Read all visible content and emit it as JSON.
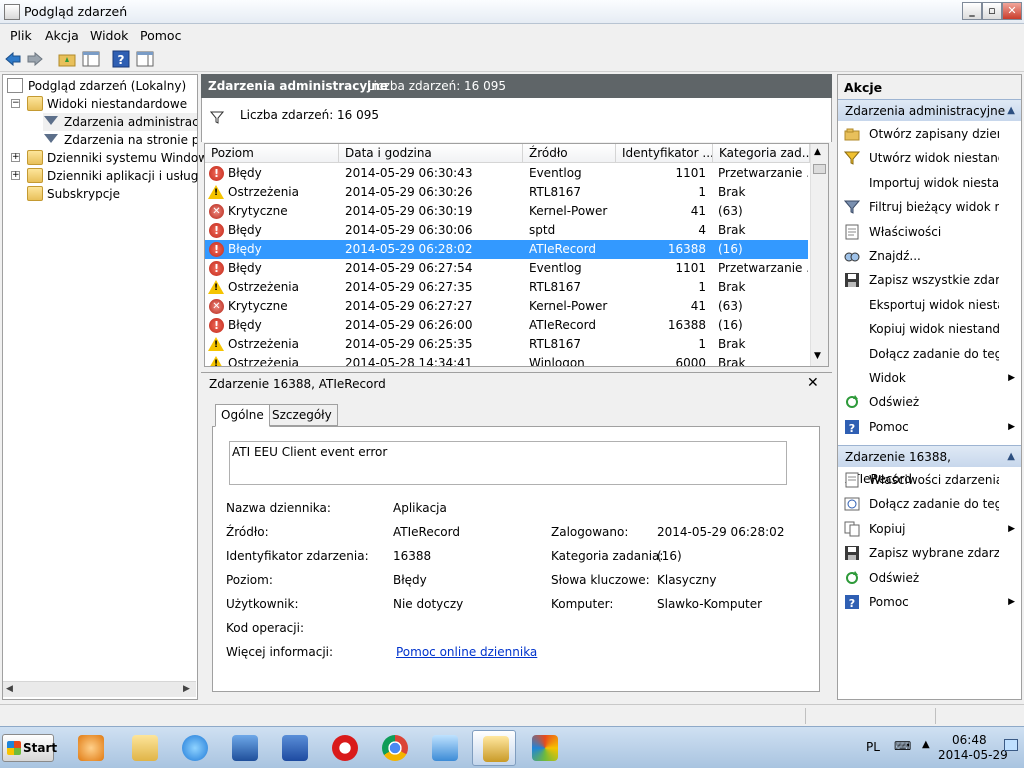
{
  "window": {
    "title": "Podgląd zdarzeń"
  },
  "menu": [
    "Plik",
    "Akcja",
    "Widok",
    "Pomoc"
  ],
  "tree": {
    "root": "Podgląd zdarzeń (Lokalny)",
    "custom_views": "Widoki niestandardowe",
    "admin_events": "Zdarzenia administracyjne",
    "page_events": "Zdarzenia na stronie pod",
    "windows_logs": "Dzienniki systemu Windows",
    "app_logs": "Dzienniki aplikacji i usług",
    "subscriptions": "Subskrypcje"
  },
  "center": {
    "title": "Zdarzenia administracyjne",
    "count_header": "Liczba zdarzeń: 16 095",
    "filter_text": "Liczba zdarzeń: 16 095"
  },
  "table": {
    "columns": [
      "Poziom",
      "Data i godzina",
      "Źródło",
      "Identyfikator ...",
      "Kategoria zad..."
    ],
    "rows": [
      {
        "level": "Błędy",
        "type": "error",
        "date": "2014-05-29 06:30:43",
        "source": "Eventlog",
        "id": "1101",
        "category": "Przetwarzanie ..."
      },
      {
        "level": "Ostrzeżenia",
        "type": "warning",
        "date": "2014-05-29 06:30:26",
        "source": "RTL8167",
        "id": "1",
        "category": "Brak"
      },
      {
        "level": "Krytyczne",
        "type": "critical",
        "date": "2014-05-29 06:30:19",
        "source": "Kernel-Power",
        "id": "41",
        "category": "(63)"
      },
      {
        "level": "Błędy",
        "type": "error",
        "date": "2014-05-29 06:30:06",
        "source": "sptd",
        "id": "4",
        "category": "Brak"
      },
      {
        "level": "Błędy",
        "type": "error",
        "date": "2014-05-29 06:28:02",
        "source": "ATIeRecord",
        "id": "16388",
        "category": "(16)",
        "selected": true
      },
      {
        "level": "Błędy",
        "type": "error",
        "date": "2014-05-29 06:27:54",
        "source": "Eventlog",
        "id": "1101",
        "category": "Przetwarzanie ..."
      },
      {
        "level": "Ostrzeżenia",
        "type": "warning",
        "date": "2014-05-29 06:27:35",
        "source": "RTL8167",
        "id": "1",
        "category": "Brak"
      },
      {
        "level": "Krytyczne",
        "type": "critical",
        "date": "2014-05-29 06:27:27",
        "source": "Kernel-Power",
        "id": "41",
        "category": "(63)"
      },
      {
        "level": "Błędy",
        "type": "error",
        "date": "2014-05-29 06:26:00",
        "source": "ATIeRecord",
        "id": "16388",
        "category": "(16)"
      },
      {
        "level": "Ostrzeżenia",
        "type": "warning",
        "date": "2014-05-29 06:25:35",
        "source": "RTL8167",
        "id": "1",
        "category": "Brak"
      },
      {
        "level": "Ostrzeżenia",
        "type": "warning",
        "date": "2014-05-28 14:34:41",
        "source": "Winlogon",
        "id": "6000",
        "category": "Brak"
      }
    ]
  },
  "detail": {
    "title": "Zdarzenie 16388, ATIeRecord",
    "tabs": [
      "Ogólne",
      "Szczegóły"
    ],
    "message": "ATI EEU Client event error",
    "log_name_label": "Nazwa dziennika:",
    "log_name": "Aplikacja",
    "source_label": "Źródło:",
    "source": "ATIeRecord",
    "logged_label": "Zalogowano:",
    "logged": "2014-05-29 06:28:02",
    "event_id_label": "Identyfikator zdarzenia:",
    "event_id": "16388",
    "task_label": "Kategoria zadania:",
    "task": "(16)",
    "level_label": "Poziom:",
    "level": "Błędy",
    "keywords_label": "Słowa kluczowe:",
    "keywords": "Klasyczny",
    "user_label": "Użytkownik:",
    "user": "Nie dotyczy",
    "computer_label": "Komputer:",
    "computer": "Slawko-Komputer",
    "opcode_label": "Kod operacji:",
    "more_info_label": "Więcej informacji:",
    "more_info_link": "Pomoc online dziennika"
  },
  "actions": {
    "title": "Akcje",
    "section1": "Zdarzenia administracyjne",
    "items1": [
      "Otwórz zapisany dzien...",
      "Utwórz widok niestand...",
      "Importuj widok niesta...",
      "Filtruj bieżący widok ni...",
      "Właściwości",
      "Znajdź...",
      "Zapisz wszystkie zdarze...",
      "Eksportuj widok niesta...",
      "Kopiuj widok niestand...",
      "Dołącz zadanie do teg...",
      "Widok",
      "Odśwież",
      "Pomoc"
    ],
    "section2": "Zdarzenie 16388, ATIeRecord",
    "items2": [
      "Właściwości zdarzenia",
      "Dołącz zadanie do teg...",
      "Kopiuj",
      "Zapisz wybrane zdarze...",
      "Odśwież",
      "Pomoc"
    ]
  },
  "taskbar": {
    "start": "Start",
    "lang": "PL",
    "time": "06:48",
    "date": "2014-05-29"
  }
}
